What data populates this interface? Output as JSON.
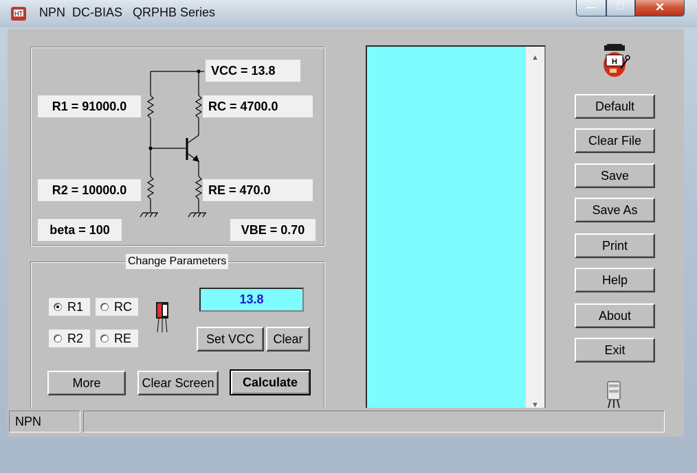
{
  "window": {
    "title": "NPN  DC-BIAS   QRPHB Series",
    "controls": {
      "minimize": "—",
      "maximize": "□",
      "close": "✕"
    }
  },
  "circuit": {
    "vcc": "VCC = 13.8",
    "r1": "R1 = 91000.0",
    "rc": "RC = 4700.0",
    "r2": "R2 = 10000.0",
    "re": "RE = 470.0",
    "beta": "beta = 100",
    "vbe": "VBE = 0.70"
  },
  "params": {
    "group_label": "Change Parameters",
    "radios": [
      {
        "label": "R1",
        "checked": true
      },
      {
        "label": "RC",
        "checked": false
      },
      {
        "label": "R2",
        "checked": false
      },
      {
        "label": "RE",
        "checked": false
      }
    ],
    "input_value": "13.8",
    "set_vcc": "Set VCC",
    "clear": "Clear",
    "more": "More",
    "clear_screen": "Clear Screen",
    "calculate": "Calculate"
  },
  "side_buttons": [
    "Default",
    "Clear File",
    "Save",
    "Save As",
    "Print",
    "Help",
    "About",
    "Exit"
  ],
  "status": {
    "mode": "NPN",
    "message": ""
  },
  "colors": {
    "cyan": "#7ffcff",
    "face": "#c0c0c0",
    "input_text": "#1a1acc"
  }
}
